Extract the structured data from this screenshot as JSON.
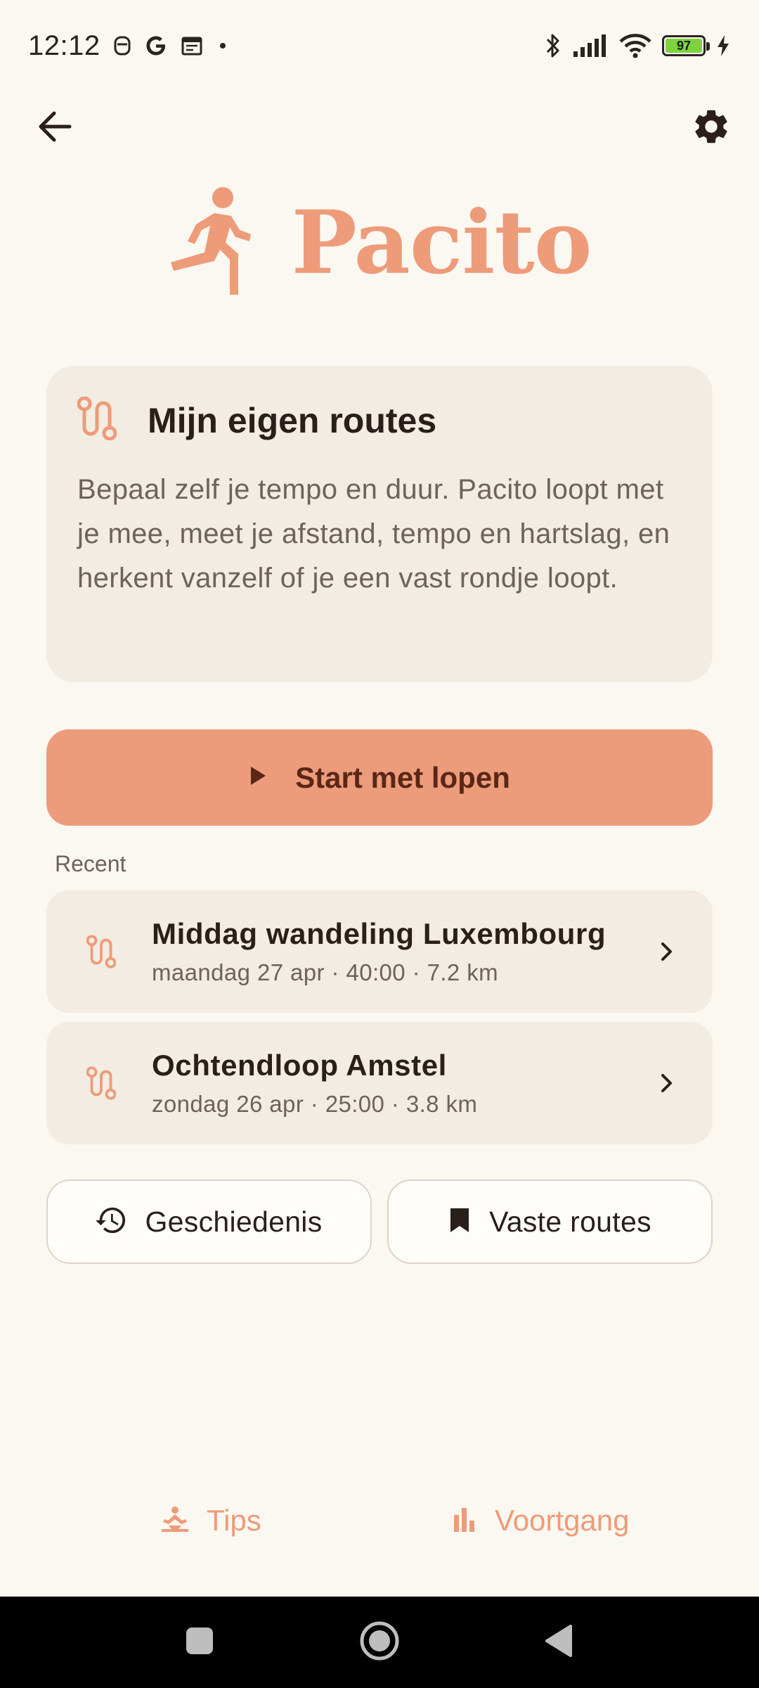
{
  "status_bar": {
    "time": "12:12",
    "battery": "97",
    "icons_left": [
      "notification-icon",
      "google-icon",
      "calendar-icon",
      "dot-icon"
    ],
    "icons_right": [
      "bluetooth-icon",
      "signal-icon",
      "wifi-icon",
      "battery-icon",
      "charging-icon"
    ]
  },
  "app": {
    "name": "Pacito",
    "accent_color": "#EE9B79",
    "card_color": "#F2ECE2",
    "background_color": "#FBF7F1"
  },
  "info_card": {
    "title": "Mijn eigen routes",
    "body": "Bepaal zelf je tempo en duur. Pacito loopt met je mee, meet je afstand, tempo en hartslag, en herkent vanzelf of je een vast rondje loopt."
  },
  "start_button": {
    "label": "Start met lopen"
  },
  "recent": {
    "label": "Recent",
    "items": [
      {
        "title": "Middag wandeling Luxembourg",
        "subtitle": "maandag 27 apr · 40:00 · 7.2 km"
      },
      {
        "title": "Ochtendloop Amstel",
        "subtitle": "zondag 26 apr · 25:00 · 3.8 km"
      }
    ]
  },
  "actions": {
    "history_label": "Geschiedenis",
    "fixed_routes_label": "Vaste routes"
  },
  "bottom_nav": {
    "tips_label": "Tips",
    "progress_label": "Voortgang"
  }
}
